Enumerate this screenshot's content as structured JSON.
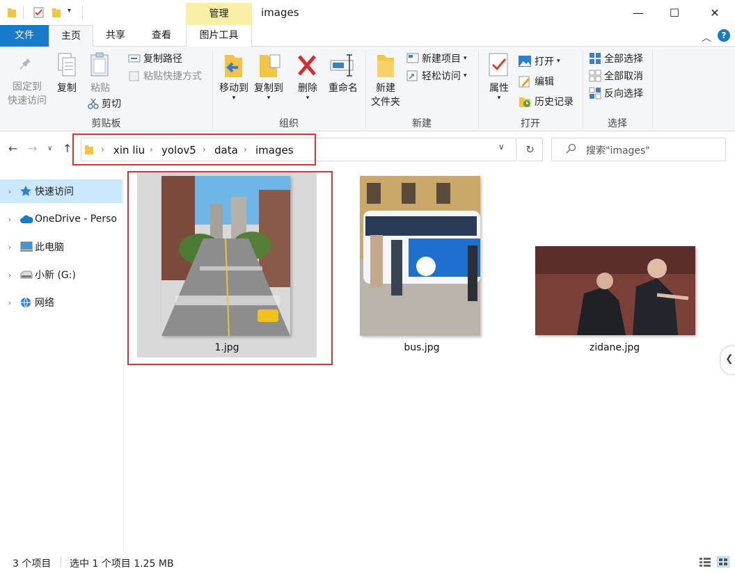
{
  "window": {
    "title": "images",
    "contextual_tab_group": "管理",
    "controls": {
      "minimize": "—",
      "maximize": "☐",
      "close": "✕"
    }
  },
  "ribbon_tabs": [
    "文件",
    "主页",
    "共享",
    "查看",
    "图片工具"
  ],
  "ribbon": {
    "clipboard": {
      "pin_label_line1": "固定到",
      "pin_label_line2": "快速访问",
      "copy": "复制",
      "paste": "粘贴",
      "copy_path": "复制路径",
      "paste_shortcut": "粘贴快捷方式",
      "cut": "剪切",
      "group": "剪贴板"
    },
    "organize": {
      "move_to": "移动到",
      "copy_to": "复制到",
      "delete": "删除",
      "rename": "重命名",
      "group": "组织"
    },
    "new": {
      "new_folder_line1": "新建",
      "new_folder_line2": "文件夹",
      "new_item": "新建项目",
      "easy_access": "轻松访问",
      "group": "新建"
    },
    "open": {
      "properties": "属性",
      "open": "打开",
      "edit": "编辑",
      "history": "历史记录",
      "group": "打开"
    },
    "select": {
      "select_all": "全部选择",
      "select_none": "全部取消",
      "invert": "反向选择",
      "group": "选择"
    }
  },
  "address": {
    "crumbs": [
      "xin liu",
      "yolov5",
      "data",
      "images"
    ],
    "search_placeholder": "搜索\"images\""
  },
  "nav_pane": {
    "items": [
      {
        "label": "快速访问",
        "icon": "star-icon",
        "selected": true
      },
      {
        "label": "OneDrive - Perso",
        "icon": "cloud-icon",
        "selected": false
      },
      {
        "label": "此电脑",
        "icon": "computer-icon",
        "selected": false
      },
      {
        "label": "小新 (G:)",
        "icon": "drive-icon",
        "selected": false
      },
      {
        "label": "网络",
        "icon": "network-icon",
        "selected": false
      }
    ]
  },
  "files": [
    {
      "name": "1.jpg",
      "selected": true
    },
    {
      "name": "bus.jpg",
      "selected": false
    },
    {
      "name": "zidane.jpg",
      "selected": false
    }
  ],
  "status": {
    "count": "3 个项目",
    "selection": "选中 1 个项目  1.25 MB"
  },
  "colors": {
    "accent": "#1979ca",
    "selection": "#cce8ff",
    "highlight_annotation": "#e03030",
    "manage_tab": "#f9f0a5"
  }
}
